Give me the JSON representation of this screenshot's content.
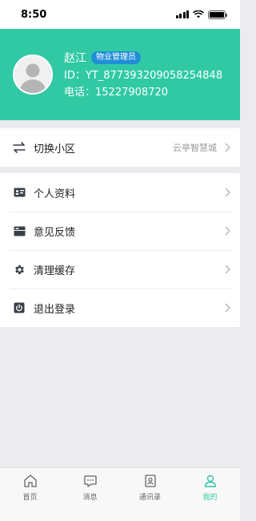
{
  "status_bar": {
    "time": "8:50"
  },
  "profile": {
    "name": "赵江",
    "role": "物业管理员",
    "id_line": "ID：YT_877393209058254848",
    "phone_line": "电话：15227908720"
  },
  "community": {
    "label": "切换小区",
    "value": "云亭智慧城",
    "icon": "swap-arrows-icon"
  },
  "menu": [
    {
      "label": "个人资料",
      "icon": "id-card-icon"
    },
    {
      "label": "意见反馈",
      "icon": "folder-icon"
    },
    {
      "label": "清理缓存",
      "icon": "gear-icon"
    },
    {
      "label": "退出登录",
      "icon": "power-icon"
    }
  ],
  "tabs": [
    {
      "label": "首页",
      "icon": "home-icon"
    },
    {
      "label": "消息",
      "icon": "message-icon"
    },
    {
      "label": "通讯录",
      "icon": "contacts-icon"
    },
    {
      "label": "我的",
      "icon": "user-icon"
    }
  ],
  "colors": {
    "accent": "#30c9a4",
    "badge": "#1f8ed6",
    "icon": "#3a3f47"
  }
}
